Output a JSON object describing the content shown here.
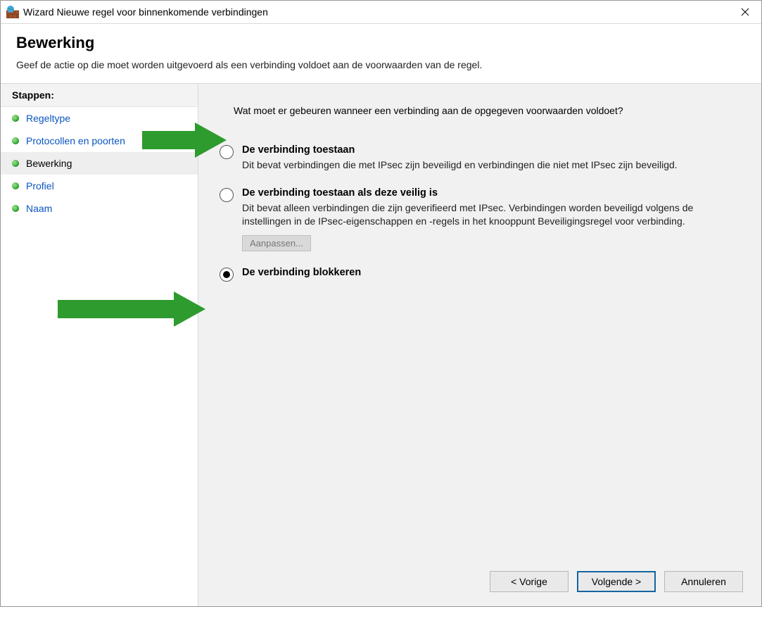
{
  "titlebar": {
    "title": "Wizard Nieuwe regel voor binnenkomende verbindingen"
  },
  "header": {
    "title": "Bewerking",
    "subtitle": "Geef de actie op die moet worden uitgevoerd als een verbinding voldoet aan de voorwaarden van de regel."
  },
  "sidebar": {
    "steps_label": "Stappen:",
    "items": [
      {
        "label": "Regeltype",
        "current": false
      },
      {
        "label": "Protocollen en poorten",
        "current": false
      },
      {
        "label": "Bewerking",
        "current": true
      },
      {
        "label": "Profiel",
        "current": false
      },
      {
        "label": "Naam",
        "current": false
      }
    ]
  },
  "main": {
    "question": "Wat moet er gebeuren wanneer een verbinding aan de opgegeven voorwaarden voldoet?",
    "options": [
      {
        "title": "De verbinding toestaan",
        "desc": "Dit bevat verbindingen die met IPsec zijn beveiligd en verbindingen die niet met IPsec zijn beveiligd.",
        "selected": false
      },
      {
        "title": "De verbinding toestaan als deze veilig is",
        "desc": "Dit bevat alleen verbindingen die zijn geverifieerd met IPsec. Verbindingen worden beveiligd volgens de instellingen in de IPsec-eigenschappen en -regels in het knooppunt Beveiligingsregel voor verbinding.",
        "customize_label": "Aanpassen...",
        "selected": false
      },
      {
        "title": "De verbinding blokkeren",
        "desc": "",
        "selected": true
      }
    ]
  },
  "footer": {
    "back": "< Vorige",
    "next": "Volgende >",
    "cancel": "Annuleren"
  }
}
